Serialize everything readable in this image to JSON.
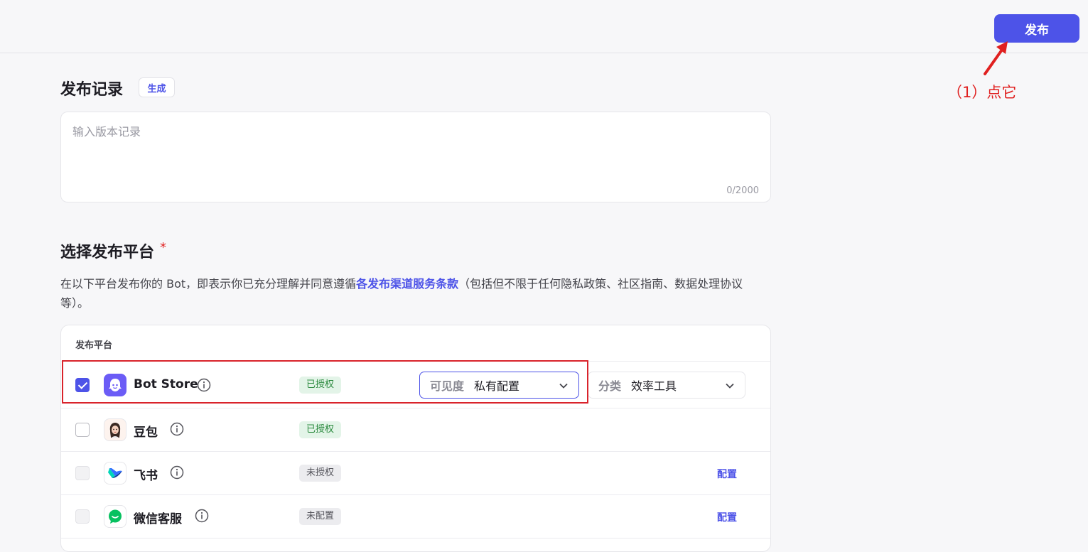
{
  "header": {
    "publish_label": "发布"
  },
  "annotation": {
    "text": "（1）点它",
    "color": "#e02020"
  },
  "record": {
    "title": "发布记录",
    "generate_label": "生成",
    "placeholder": "输入版本记录",
    "value": "",
    "counter": "0/2000"
  },
  "platforms": {
    "title": "选择发布平台",
    "required_mark": "*",
    "desc_before": "在以下平台发布你的 Bot，即表示你已充分理解并同意遵循",
    "desc_link": "各发布渠道服务条款",
    "desc_after": "（包括但不限于任何隐私政策、社区指南、数据处理协议等）。",
    "table_header": "发布平台",
    "rows": [
      {
        "name": "Bot Store",
        "status": "已授权",
        "checked": true,
        "visibility_label": "可见度",
        "visibility_value": "私有配置",
        "category_label": "分类",
        "category_value": "效率工具"
      },
      {
        "name": "豆包",
        "status": "已授权",
        "checked": false
      },
      {
        "name": "飞书",
        "status": "未授权",
        "checked": false,
        "action": "配置"
      },
      {
        "name": "微信客服",
        "status": "未配置",
        "checked": false,
        "action": "配置"
      }
    ]
  },
  "colors": {
    "accent": "#4d53e8",
    "annotation_red": "#e02020",
    "authorized_bg": "#e3f4e8",
    "authorized_text": "#2b8a3e",
    "wechat_green": "#07c160"
  }
}
